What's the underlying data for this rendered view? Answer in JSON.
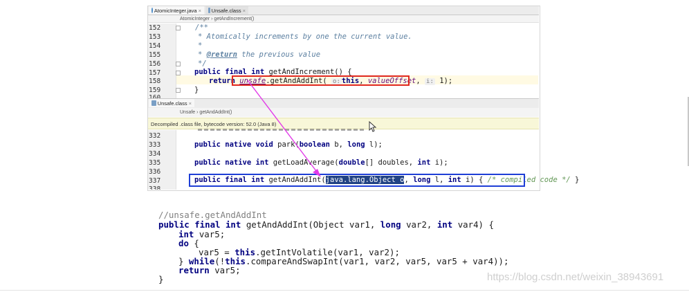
{
  "top_tabs": [
    {
      "label": "AtomicInteger.java"
    },
    {
      "label": "Unsafe.class"
    }
  ],
  "breadcrumb1": {
    "class": "AtomicInteger",
    "method": "getAndIncrement()"
  },
  "editor1": {
    "lines": [
      {
        "num": "152",
        "code": "/**"
      },
      {
        "num": "153",
        "code": "* Atomically increments by one the current value."
      },
      {
        "num": "154",
        "code": "*"
      },
      {
        "num": "155",
        "tag": "@return",
        "rest": " the previous value"
      },
      {
        "num": "156",
        "code": "*/"
      },
      {
        "num": "157",
        "mods": "public final int",
        "rest": " getAndIncrement() {"
      },
      {
        "num": "158",
        "kw": "return",
        "field": "unsafe",
        "call": ".getAndAddInt(",
        "hint1": "o:",
        "this": "this",
        "sep": ", ",
        "field2": "valueOffset",
        "sep2": ", ",
        "hint2": "i:",
        "arg": " 1);"
      },
      {
        "num": "159",
        "code": "}"
      },
      {
        "num": "160",
        "code": ""
      }
    ]
  },
  "bottom_tab": {
    "label": "Unsafe.class"
  },
  "breadcrumb2": {
    "class": "Unsafe",
    "method": "getAndAddInt()"
  },
  "notice": "Decompiled .class file, bytecode version: 52.0 (Java 8)",
  "editor2": {
    "lines": [
      {
        "num": "332",
        "code": ""
      },
      {
        "num": "333",
        "mods": "public native void",
        "rest": " park(",
        "kw2": "boolean",
        "rest2": " b, ",
        "kw3": "long",
        "rest3": " l);"
      },
      {
        "num": "334",
        "code": ""
      },
      {
        "num": "335",
        "mods": "public native int",
        "rest": " getLoadAverage(",
        "kw2": "double",
        "rest2": "[] doubles, ",
        "kw3": "int",
        "rest3": " i);"
      },
      {
        "num": "336",
        "code": ""
      },
      {
        "num": "337",
        "mods": "public final int",
        "rest": " getAndAddInt(",
        "sel": "java.lang.Object o",
        "rest2": ", ",
        "kw2": "long",
        "rest3": " l, ",
        "kw3": "int",
        "rest4": " i) { ",
        "cmt": "/* compiled code */",
        "end": " }"
      },
      {
        "num": "338",
        "code": ""
      }
    ]
  },
  "snippet": {
    "l1": "//unsafe.getAndAddInt",
    "l2a": "public final int",
    "l2b": " getAndAddInt(Object var1, ",
    "l2c": "long",
    "l2d": " var2, ",
    "l2e": "int",
    "l2f": " var4) {",
    "l3a": "int",
    "l3b": " var5;",
    "l4a": "do",
    "l4b": " {",
    "l5a": "var5 = ",
    "l5b": "this",
    "l5c": ".getIntVolatile(var1, var2);",
    "l6a": "} ",
    "l6b": "while",
    "l6c": "(!",
    "l6d": "this",
    "l6e": ".compareAndSwapInt(var1, var2, var5, var5 + var4));",
    "l7a": "return",
    "l7b": " var5;",
    "l8": "}"
  },
  "watermark": "https://blog.csdn.net/weixin_38943691",
  "colors": {
    "red_box": "#e0281e",
    "blue_box": "#1e3ed6",
    "arrow": "#e23be8",
    "selection": "#214283"
  }
}
